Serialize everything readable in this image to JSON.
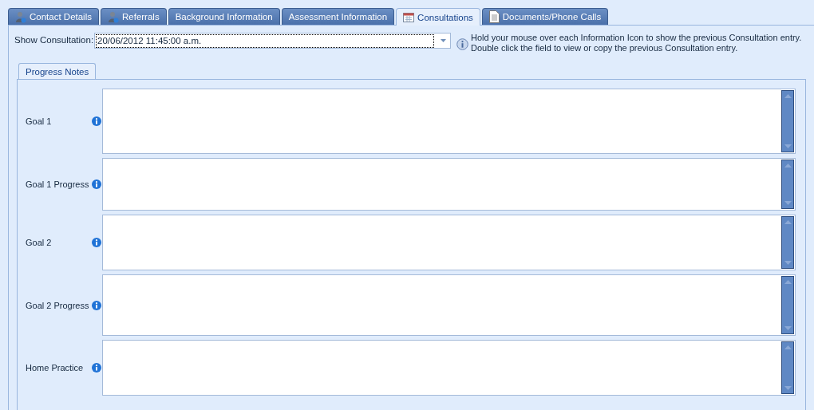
{
  "tabs": [
    {
      "label": "Contact Details",
      "selected": false,
      "kind": "person"
    },
    {
      "label": "Referrals",
      "selected": false,
      "kind": "person"
    },
    {
      "label": "Background Information",
      "selected": false,
      "kind": "plain"
    },
    {
      "label": "Assessment Information",
      "selected": false,
      "kind": "plain"
    },
    {
      "label": "Consultations",
      "selected": true,
      "kind": "calendar"
    },
    {
      "label": "Documents/Phone Calls",
      "selected": false,
      "kind": "document"
    }
  ],
  "show_consultation": {
    "label": "Show Consultation:",
    "value": "20/06/2012 11:45:00 a.m."
  },
  "hint": [
    "Hold your mouse over each Information Icon to show the previous Consultation entry.",
    "Double click the field to view or copy the previous Consultation entry."
  ],
  "inner_tabs": [
    {
      "label": "Progress Notes",
      "selected": true
    }
  ],
  "fields": [
    {
      "label": "Goal 1"
    },
    {
      "label": "Goal 1 Progress"
    },
    {
      "label": "Goal 2"
    },
    {
      "label": "Goal 2 Progress"
    },
    {
      "label": "Home Practice"
    }
  ]
}
